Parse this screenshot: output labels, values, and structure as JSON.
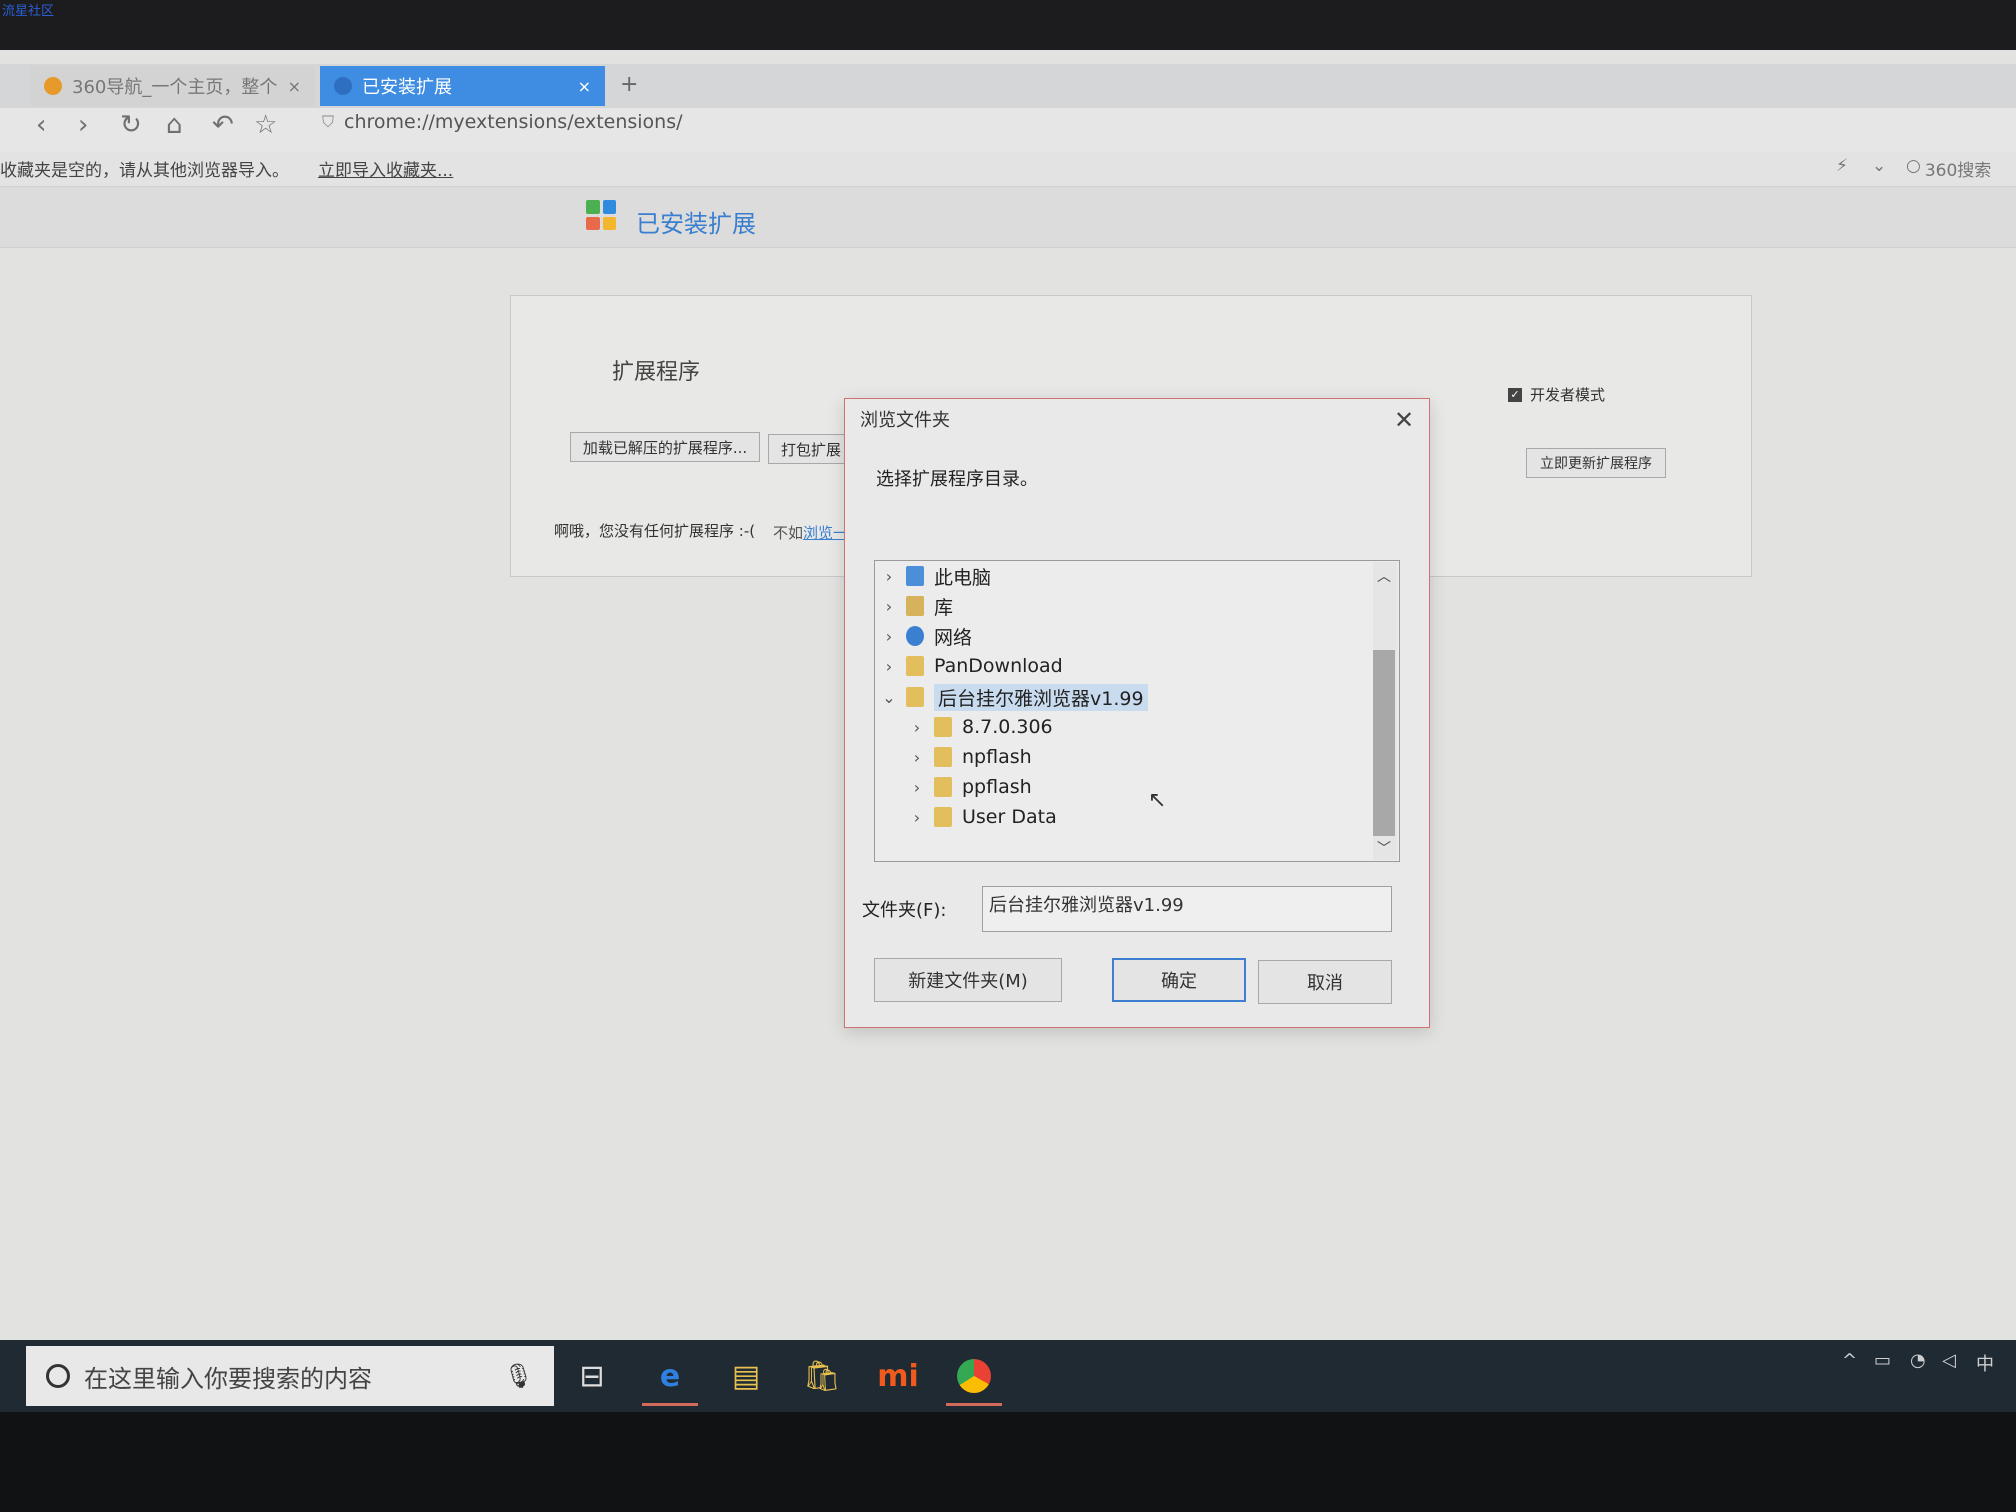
{
  "watermark": "流星社区",
  "browser": {
    "tabs": [
      {
        "label": "360导航_一个主页，整个",
        "close": "×"
      },
      {
        "label": "已安装扩展",
        "close": "×"
      }
    ],
    "new_tab": "+",
    "nav_icons": [
      "back-icon",
      "forward-icon",
      "reload-icon",
      "home-icon",
      "undo-icon",
      "star-icon"
    ],
    "url": "chrome://myextensions/extensions/",
    "bookmark_msg": "收藏夹是空的，请从其他浏览器导入。",
    "bookmark_link": "立即导入收藏夹...",
    "search_engine": "360搜索"
  },
  "page": {
    "title": "已安装扩展",
    "ext_heading": "扩展程序",
    "load_unpacked": "加载已解压的扩展程序...",
    "pack_ext": "打包扩展",
    "dev_mode_label": "开发者模式",
    "dev_mode_checked": true,
    "update_now": "立即更新扩展程序",
    "no_ext_msg": "啊哦，您没有任何扩展程序 :-(",
    "no_ext_msg2": "不如",
    "browse_link": "浏览一"
  },
  "dialog": {
    "title": "浏览文件夹",
    "close": "✕",
    "prompt": "选择扩展程序目录。",
    "tree": [
      {
        "label": "此电脑",
        "icon": "computer-icon",
        "level": 0,
        "expanded": false
      },
      {
        "label": "库",
        "icon": "library-icon",
        "level": 0,
        "expanded": false
      },
      {
        "label": "网络",
        "icon": "network-icon",
        "level": 0,
        "expanded": false
      },
      {
        "label": "PanDownload",
        "icon": "folder-icon",
        "level": 0,
        "expanded": false
      },
      {
        "label": "后台挂尔雅浏览器v1.99",
        "icon": "folder-icon",
        "level": 0,
        "expanded": true,
        "selected": true
      },
      {
        "label": "8.7.0.306",
        "icon": "folder-icon",
        "level": 1,
        "expanded": false
      },
      {
        "label": "npflash",
        "icon": "folder-icon",
        "level": 1,
        "expanded": false
      },
      {
        "label": "ppflash",
        "icon": "folder-icon",
        "level": 1,
        "expanded": false
      },
      {
        "label": "User Data",
        "icon": "folder-icon",
        "level": 1,
        "expanded": false
      }
    ],
    "folder_label": "文件夹(F):",
    "folder_value": "后台挂尔雅浏览器v1.99",
    "new_folder": "新建文件夹(M)",
    "ok": "确定",
    "cancel": "取消"
  },
  "taskbar": {
    "search_placeholder": "在这里输入你要搜索的内容",
    "apps": [
      "task-view-icon",
      "edge-icon",
      "file-explorer-icon",
      "store-icon",
      "mi-icon",
      "chrome-icon"
    ],
    "ime": "中"
  },
  "colors": {
    "accent": "#3f8de2",
    "tab_active": "#3f8de2",
    "selection": "#c9dcef",
    "taskbar": "#1f2a33"
  }
}
